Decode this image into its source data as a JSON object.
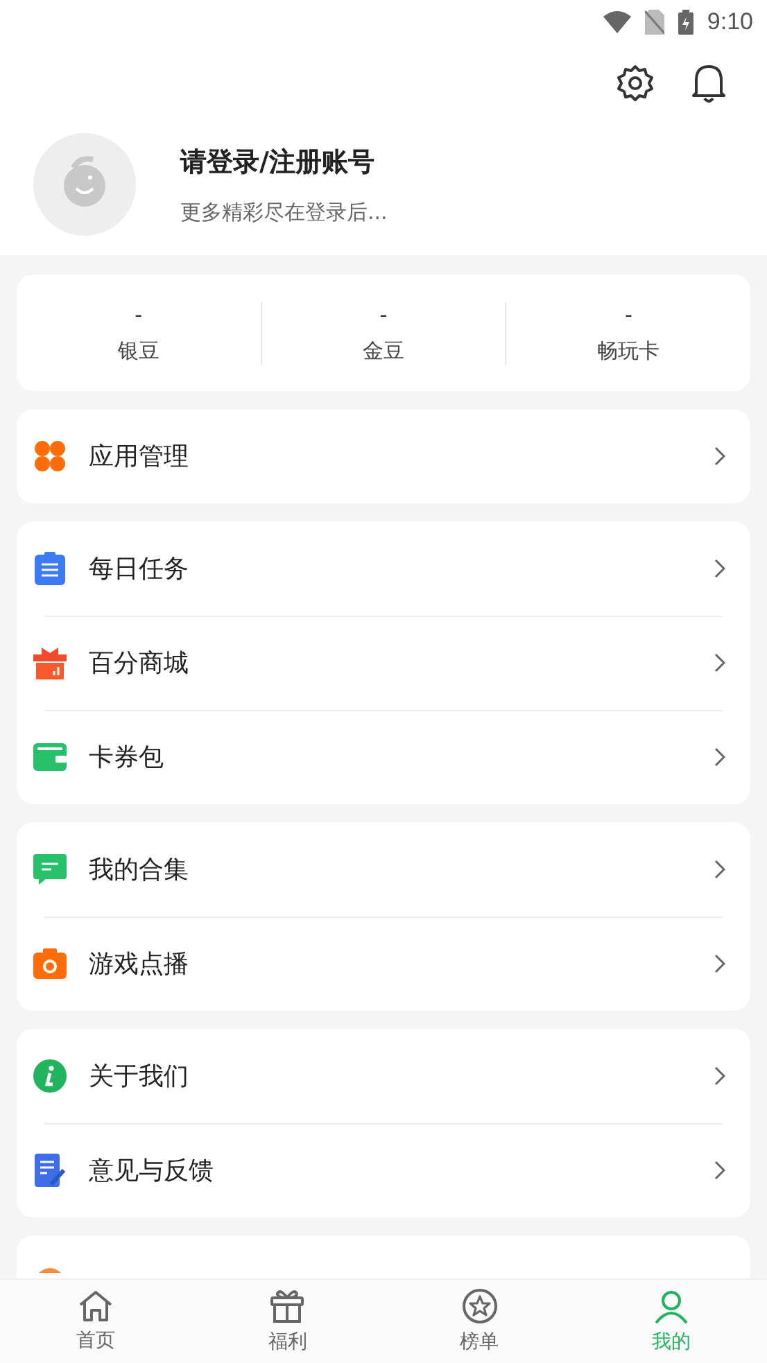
{
  "status_bar": {
    "time": "9:10"
  },
  "profile": {
    "title": "请登录/注册账号",
    "subtitle": "更多精彩尽在登录后..."
  },
  "stats": [
    {
      "value": "-",
      "label": "银豆"
    },
    {
      "value": "-",
      "label": "金豆"
    },
    {
      "value": "-",
      "label": "畅玩卡"
    }
  ],
  "groups": [
    [
      {
        "kind": "apps",
        "label": "应用管理"
      }
    ],
    [
      {
        "kind": "tasks",
        "label": "每日任务"
      },
      {
        "kind": "gift",
        "label": "百分商城"
      },
      {
        "kind": "wallet",
        "label": "卡券包"
      }
    ],
    [
      {
        "kind": "chat",
        "label": "我的合集"
      },
      {
        "kind": "camera",
        "label": "游戏点播"
      }
    ],
    [
      {
        "kind": "info",
        "label": "关于我们"
      },
      {
        "kind": "feedback",
        "label": "意见与反馈"
      }
    ]
  ],
  "tabs": [
    {
      "kind": "home",
      "label": "首页",
      "selected": false
    },
    {
      "kind": "gift",
      "label": "福利",
      "selected": false
    },
    {
      "kind": "star",
      "label": "榜单",
      "selected": false
    },
    {
      "kind": "user",
      "label": "我的",
      "selected": true
    }
  ]
}
